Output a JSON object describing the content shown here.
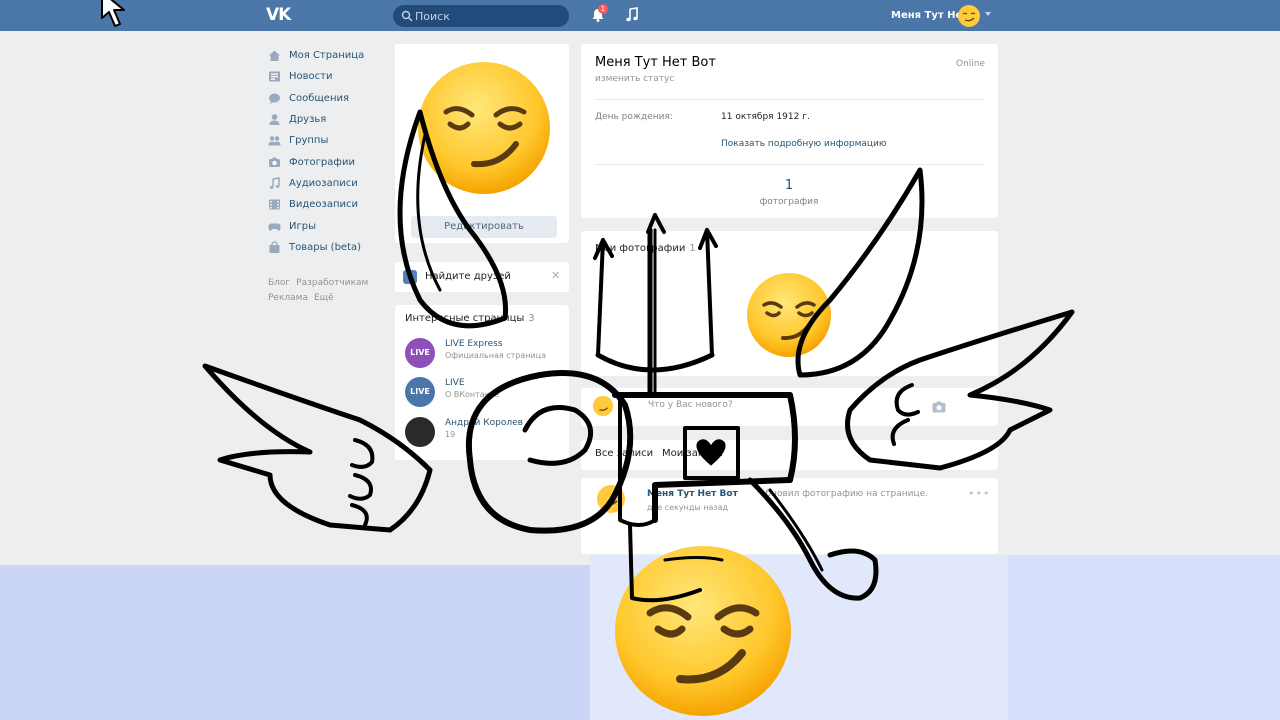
{
  "header": {
    "logo": "VK",
    "search_placeholder": "Поиск",
    "notifications_badge": "1",
    "user_name": "Меня Тут Нет"
  },
  "menu": {
    "items": [
      {
        "label": "Моя Страница",
        "icon": "home-icon"
      },
      {
        "label": "Новости",
        "icon": "news-icon"
      },
      {
        "label": "Сообщения",
        "icon": "messages-icon"
      },
      {
        "label": "Друзья",
        "icon": "friends-icon"
      },
      {
        "label": "Группы",
        "icon": "groups-icon"
      },
      {
        "label": "Фотографии",
        "icon": "camera-icon"
      },
      {
        "label": "Аудиозаписи",
        "icon": "music-icon"
      },
      {
        "label": "Видеозаписи",
        "icon": "video-icon"
      },
      {
        "label": "Игры",
        "icon": "gamepad-icon"
      },
      {
        "label": "Товары (beta)",
        "icon": "bag-icon"
      }
    ],
    "footer": {
      "blog": "Блог",
      "developers": "Разработчикам",
      "ads": "Реклама",
      "more": "Ещё"
    }
  },
  "avatar_block": {
    "edit_label": "Редактировать"
  },
  "find_friends": {
    "label": "Найдите друзей"
  },
  "interesting_pages": {
    "title": "Интересные страницы",
    "count": "3",
    "items": [
      {
        "name": "LIVE Express",
        "sub": "Официальная страница",
        "avatar_text": "LIVE",
        "color": "#8e4fb8"
      },
      {
        "name": "LIVE",
        "sub": "О ВКонтакте",
        "avatar_text": "LIVE",
        "color": "#4a76a8"
      },
      {
        "name": "Андрей Королев",
        "sub": "19",
        "avatar_text": "",
        "color": "#2a2a2a"
      }
    ]
  },
  "profile": {
    "name": "Меня Тут Нет Вот",
    "status": "изменить статус",
    "online": "Online",
    "birthday_label": "День рождения:",
    "birthday_value": "11 октября 1912 г.",
    "details_link": "Показать подробную информацию",
    "photo_count": "1",
    "photo_count_label": "фотография"
  },
  "photos": {
    "title": "Мои фотографии",
    "count": "1"
  },
  "compose": {
    "placeholder": "Что у Вас нового?"
  },
  "wall": {
    "tab_all": "Все записи",
    "tab_mine": "Мои записи"
  },
  "post": {
    "author": "Меня Тут Нет Вот",
    "action": "обновил фотографию на странице.",
    "time": "две секунды назад"
  },
  "colors": {
    "header": "#4a76a8",
    "background": "#edeef0",
    "link": "#285473",
    "overlay_band": "#cbd6f6"
  }
}
